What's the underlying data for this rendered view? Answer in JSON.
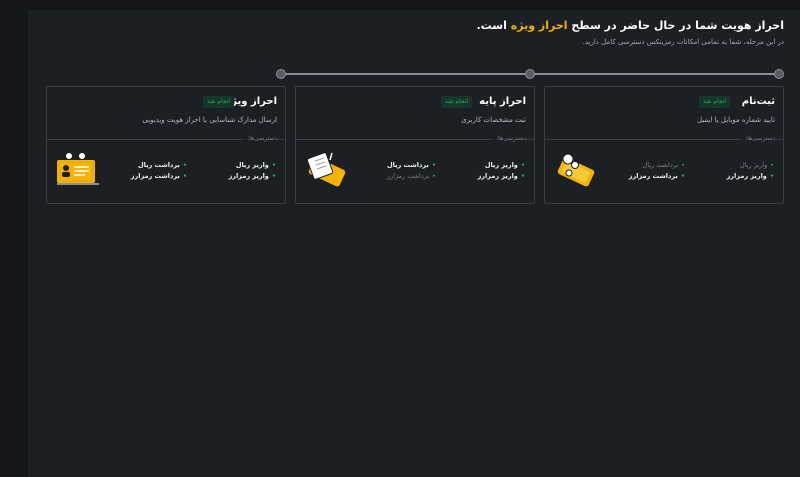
{
  "header": {
    "title_prefix": "احراز هویت شما در حال حاضر در سطح",
    "title_level": "احراز ویژه",
    "title_suffix": "است.",
    "subtitle": "در این مرحله، شما به تمامی امکانات رمزینکس دسترسی کامل دارید."
  },
  "accent_color": "#f5b400",
  "status_color": "#21b36b",
  "cards": [
    {
      "name": "ثبت‌نام",
      "status": "انجام شد",
      "description": "تایید شماره موبایل یا ایمیل",
      "access_label": "دسترسی‌ها:",
      "col1": [
        "واریز ریال",
        "واریز رمزارز"
      ],
      "col1_active": [
        false,
        true
      ],
      "col2": [
        "برداشت ریال",
        "برداشت رمزارز"
      ],
      "col2_active": [
        false,
        true
      ],
      "icon": "phone-illustration-icon"
    },
    {
      "name": "احراز پایه",
      "status": "انجام شد",
      "description": "ثبت مشخصات کاربری",
      "access_label": "دسترسی‌ها:",
      "col1": [
        "واریز ریال",
        "واریز رمزارز"
      ],
      "col1_active": [
        true,
        true
      ],
      "col2": [
        "برداشت ریال",
        "برداشت رمزارز"
      ],
      "col2_active": [
        true,
        false
      ],
      "icon": "document-illustration-icon"
    },
    {
      "name": "احراز ویژه",
      "status": "انجام شد",
      "description": "ارسال مدارک شناسایی یا احراز هویت ویدیویی",
      "access_label": "دسترسی‌ها:",
      "col1": [
        "واریز ریال",
        "واریز رمزارز"
      ],
      "col1_active": [
        true,
        true
      ],
      "col2": [
        "برداشت ریال",
        "برداشت رمزارز"
      ],
      "col2_active": [
        true,
        true
      ],
      "icon": "id-card-illustration-icon"
    }
  ]
}
